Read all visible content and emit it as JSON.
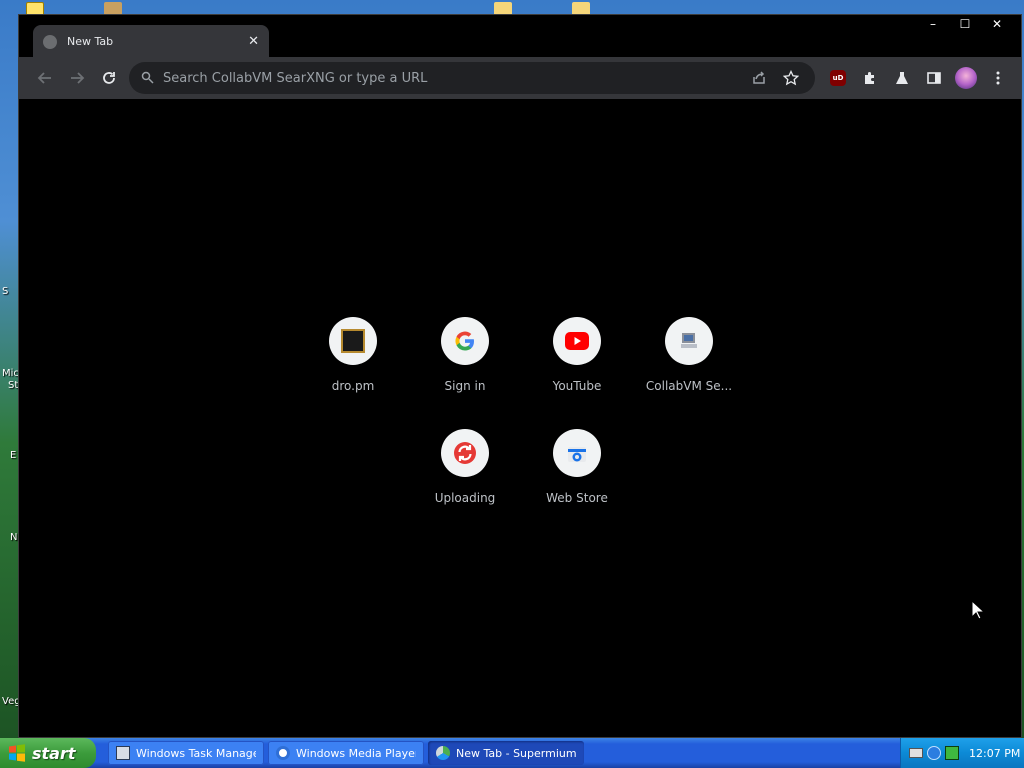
{
  "browser": {
    "tab_title": "New Tab",
    "tab_close": "✕",
    "omnibox_placeholder": "Search CollabVM SearXNG or type a URL",
    "window_controls": {
      "minimize": "–",
      "maximize": "☐",
      "close": "✕"
    },
    "extension_ublock_label": "uD",
    "icons": {
      "back": "back-arrow-icon",
      "forward": "forward-arrow-icon",
      "reload": "reload-icon",
      "site_info": "search-engine-icon",
      "share": "share-icon",
      "bookmark": "star-icon",
      "extensions": "puzzle-icon",
      "labs": "flask-icon",
      "side_panel": "side-panel-icon",
      "avatar": "avatar-icon",
      "menu": "kebab-menu-icon"
    }
  },
  "shortcuts": [
    {
      "label": "dro.pm",
      "icon": "dro-pm-favicon"
    },
    {
      "label": "Sign in",
      "icon": "google-icon"
    },
    {
      "label": "YouTube",
      "icon": "youtube-icon"
    },
    {
      "label": "CollabVM Se...",
      "icon": "collabvm-icon"
    },
    {
      "label": "Uploading",
      "icon": "uploading-icon"
    },
    {
      "label": "Web Store",
      "icon": "web-store-icon"
    }
  ],
  "taskbar": {
    "start_label": "start",
    "tasks": [
      {
        "label": "Windows Task Manager",
        "icon": "task-manager-icon",
        "active": false
      },
      {
        "label": "Windows Media Player",
        "icon": "media-player-icon",
        "active": false
      },
      {
        "label": "New Tab - Supermium",
        "icon": "supermium-icon",
        "active": true
      }
    ],
    "clock": "12:07 PM"
  },
  "desktop_labels": [
    "S",
    "Mici",
    "St",
    "E",
    "N",
    "Veg"
  ],
  "colors": {
    "youtube_red": "#ff0000",
    "ublock_red": "#800000",
    "uploading_red": "#e53935",
    "webstore_blue": "#1a73e8"
  }
}
